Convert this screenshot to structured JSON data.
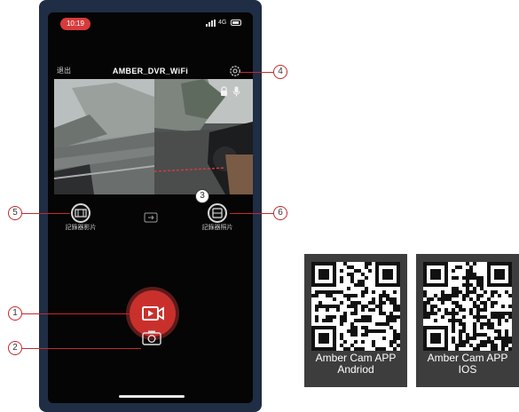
{
  "status_bar": {
    "time": "10:19",
    "network": "4G"
  },
  "nav": {
    "back_label": "退出",
    "title": "AMBER_DVR_WiFi"
  },
  "actions": {
    "video_label": "記錄器影片",
    "photo_label": "記錄器照片"
  },
  "callouts": [
    "1",
    "2",
    "3",
    "4",
    "5",
    "6"
  ],
  "qr_cards": [
    {
      "line1": "Amber Cam APP",
      "line2": "Andriod"
    },
    {
      "line1": "Amber Cam APP",
      "line2": "IOS"
    }
  ],
  "colors": {
    "record_button": "#c9302c",
    "callout": "#c8282a",
    "phone_frame": "#1f2d45",
    "qr_card": "#3d3d3d"
  },
  "icons": [
    "gear-icon",
    "lock-icon",
    "microphone-icon",
    "film-icon",
    "photo-icon",
    "switch-camera-icon",
    "video-camera-icon",
    "camera-icon"
  ]
}
